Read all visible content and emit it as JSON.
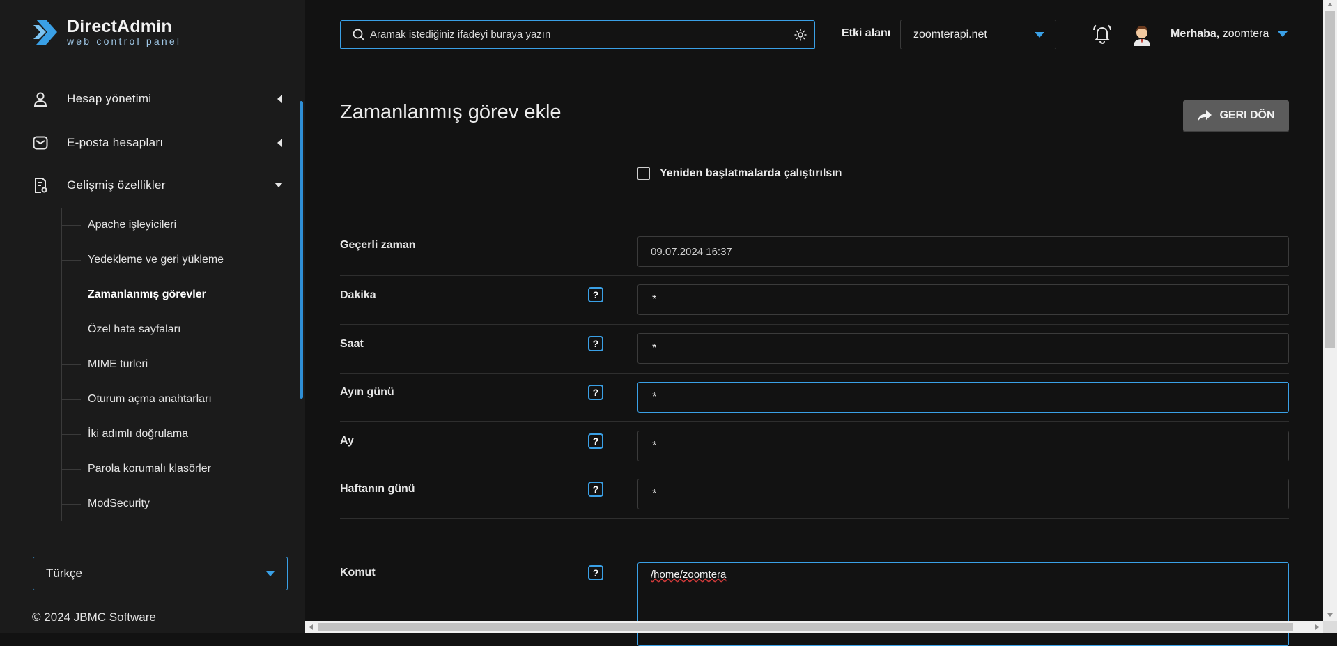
{
  "brand": {
    "title": "DirectAdmin",
    "subtitle": "web control panel",
    "accent": "#3aa0e6"
  },
  "sidebar": {
    "items": [
      {
        "label": "Hesap yönetimi",
        "icon": "user-icon",
        "state": "collapsed"
      },
      {
        "label": "E-posta hesapları",
        "icon": "mail-icon",
        "state": "collapsed"
      },
      {
        "label": "Gelişmiş özellikler",
        "icon": "advanced-icon",
        "state": "expanded"
      }
    ],
    "subitems": [
      {
        "label": "Apache işleyicileri"
      },
      {
        "label": "Yedekleme ve geri yükleme"
      },
      {
        "label": "Zamanlanmış görevler",
        "active": true
      },
      {
        "label": "Özel hata sayfaları"
      },
      {
        "label": "MIME türleri"
      },
      {
        "label": "Oturum açma anahtarları"
      },
      {
        "label": "İki adımlı doğrulama"
      },
      {
        "label": "Parola korumalı klasörler"
      },
      {
        "label": "ModSecurity"
      }
    ],
    "language": "Türkçe",
    "copyright": "© 2024 JBMC Software"
  },
  "header": {
    "search_placeholder": "Aramak istediğiniz ifadeyi buraya yazın",
    "domain_label": "Etki alanı",
    "domain_value": "zoomterapi.net",
    "greeting_prefix": "Merhaba,",
    "username": "zoomtera"
  },
  "main": {
    "title": "Zamanlanmış görev ekle",
    "back_button": "GERI DÖN",
    "reboot_checkbox_label": "Yeniden başlatmalarda çalıştırılsın",
    "reboot_checked": false,
    "current_time_label": "Geçerli zaman",
    "current_time_value": "09.07.2024 16:37",
    "fields": [
      {
        "label": "Dakika",
        "value": "*"
      },
      {
        "label": "Saat",
        "value": "*"
      },
      {
        "label": "Ayın günü",
        "value": "*"
      },
      {
        "label": "Ay",
        "value": "*"
      },
      {
        "label": "Haftanın günü",
        "value": "*"
      }
    ],
    "help_glyph": "?",
    "command_label": "Komut",
    "command_value": "/home/zoomtera"
  }
}
